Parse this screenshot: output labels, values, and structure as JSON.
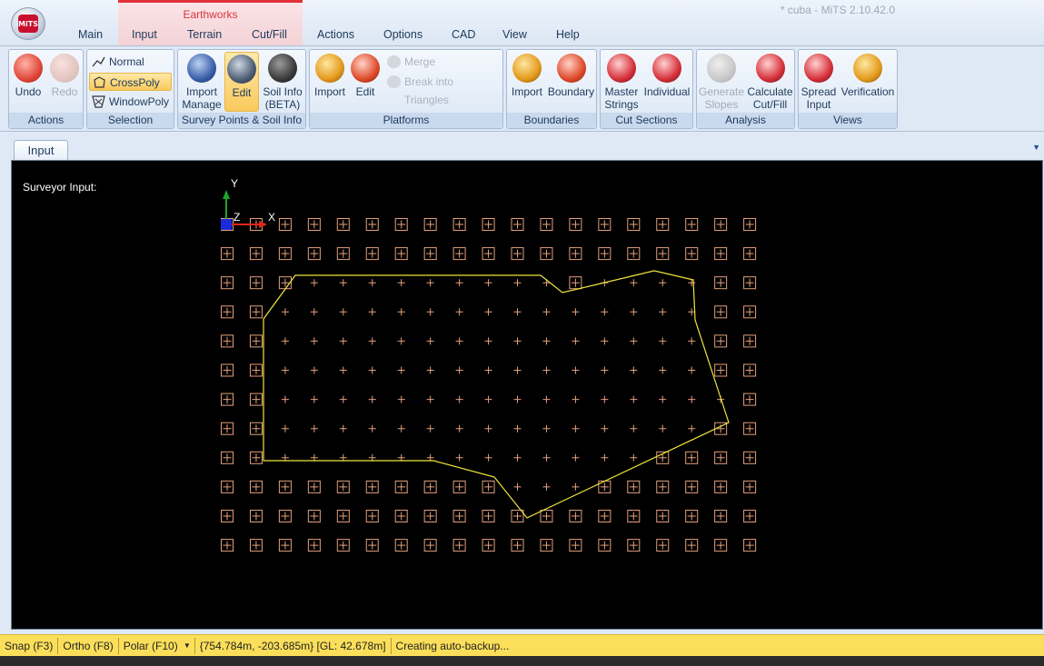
{
  "window": {
    "title": "* cuba - MiTS 2.10.42.0"
  },
  "ribbon_tabs": {
    "context_group": "Earthworks",
    "items": [
      {
        "label": "Main"
      },
      {
        "label": "Input"
      },
      {
        "label": "Terrain"
      },
      {
        "label": "Cut/Fill"
      },
      {
        "label": "Actions"
      },
      {
        "label": "Options"
      },
      {
        "label": "CAD"
      },
      {
        "label": "View"
      },
      {
        "label": "Help"
      }
    ]
  },
  "groups": {
    "actions": {
      "label": "Actions",
      "undo": "Undo",
      "redo": "Redo"
    },
    "selection": {
      "label": "Selection",
      "normal": "Normal",
      "crosspoly": "CrossPoly",
      "windowpoly": "WindowPoly"
    },
    "survey": {
      "label": "Survey Points & Soil Info",
      "import_l1": "Import",
      "import_l2": "Manage",
      "edit": "Edit",
      "soil_l1": "Soil Info",
      "soil_l2": "(BETA)"
    },
    "platforms": {
      "label": "Platforms",
      "import": "Import",
      "edit": "Edit",
      "merge": "Merge",
      "break": "Break into Triangles"
    },
    "boundaries": {
      "label": "Boundaries",
      "import": "Import",
      "boundary": "Boundary"
    },
    "cut_sections": {
      "label": "Cut Sections",
      "master_l1": "Master",
      "master_l2": "Strings",
      "individual": "Individual"
    },
    "analysis": {
      "label": "Analysis",
      "gen_l1": "Generate",
      "gen_l2": "Slopes",
      "calc_l1": "Calculate",
      "calc_l2": "Cut/Fill"
    },
    "views": {
      "label": "Views",
      "spread_l1": "Spread",
      "spread_l2": "Input",
      "verification": "Verification"
    }
  },
  "document": {
    "tab": "Input",
    "canvas_label": "Surveyor Input:"
  },
  "canvas": {
    "axis_y": "Y",
    "axis_x": "X",
    "axis_z": "Z",
    "grid_color": "#e3a07c",
    "boundary_color": "#f0e63c",
    "background": "#000000",
    "point_grid": {
      "columns": 19,
      "rows": 12
    },
    "inside_marker": "+",
    "outside_marker": "boxed-plus"
  },
  "status": {
    "snap": "Snap (F3)",
    "ortho": "Ortho (F8)",
    "polar": "Polar (F10)",
    "coords": "{754.784m, -203.685m} [GL: 42.678m]",
    "message": "Creating auto-backup..."
  },
  "colors": {
    "accent": "#fbdf5a",
    "context": "#e2303b",
    "active_button": "#f9c95c"
  }
}
